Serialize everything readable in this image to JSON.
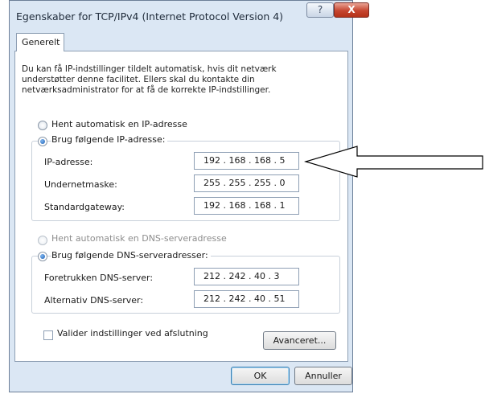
{
  "window": {
    "title": "Egenskaber for TCP/IPv4 (Internet Protocol Version 4)",
    "help_glyph": "?",
    "close_glyph": "X"
  },
  "tab": {
    "label": "Generelt"
  },
  "description": "Du kan få IP-indstillinger tildelt automatisk, hvis dit netværk understøtter denne facilitet. Ellers skal du kontakte din netværksadministrator for at få de korrekte IP-indstillinger.",
  "ip_section": {
    "auto_label": "Hent automatisk en IP-adresse",
    "manual_label": "Brug følgende IP-adresse:",
    "selected": "manual",
    "fields": [
      {
        "label": "IP-adresse:",
        "value": "192 . 168 . 168 .  5"
      },
      {
        "label": "Undernetmaske:",
        "value": "255 . 255 . 255 .  0"
      },
      {
        "label": "Standardgateway:",
        "value": "192 . 168 . 168 .  1"
      }
    ]
  },
  "dns_section": {
    "auto_label": "Hent automatisk en DNS-serveradresse",
    "manual_label": "Brug følgende DNS-serveradresser:",
    "selected": "manual",
    "fields": [
      {
        "label": "Foretrukken DNS-server:",
        "value": "212 . 242 .  40  .  3"
      },
      {
        "label": "Alternativ DNS-server:",
        "value": "212 . 242 .  40  .  51"
      }
    ]
  },
  "validate": {
    "label": "Valider indstillinger ved afslutning",
    "checked": false
  },
  "buttons": {
    "advanced": "Avanceret...",
    "ok": "OK",
    "cancel": "Annuller"
  },
  "colors": {
    "dialog_bg": "#dbe7f4",
    "close_red": "#c6452f"
  }
}
